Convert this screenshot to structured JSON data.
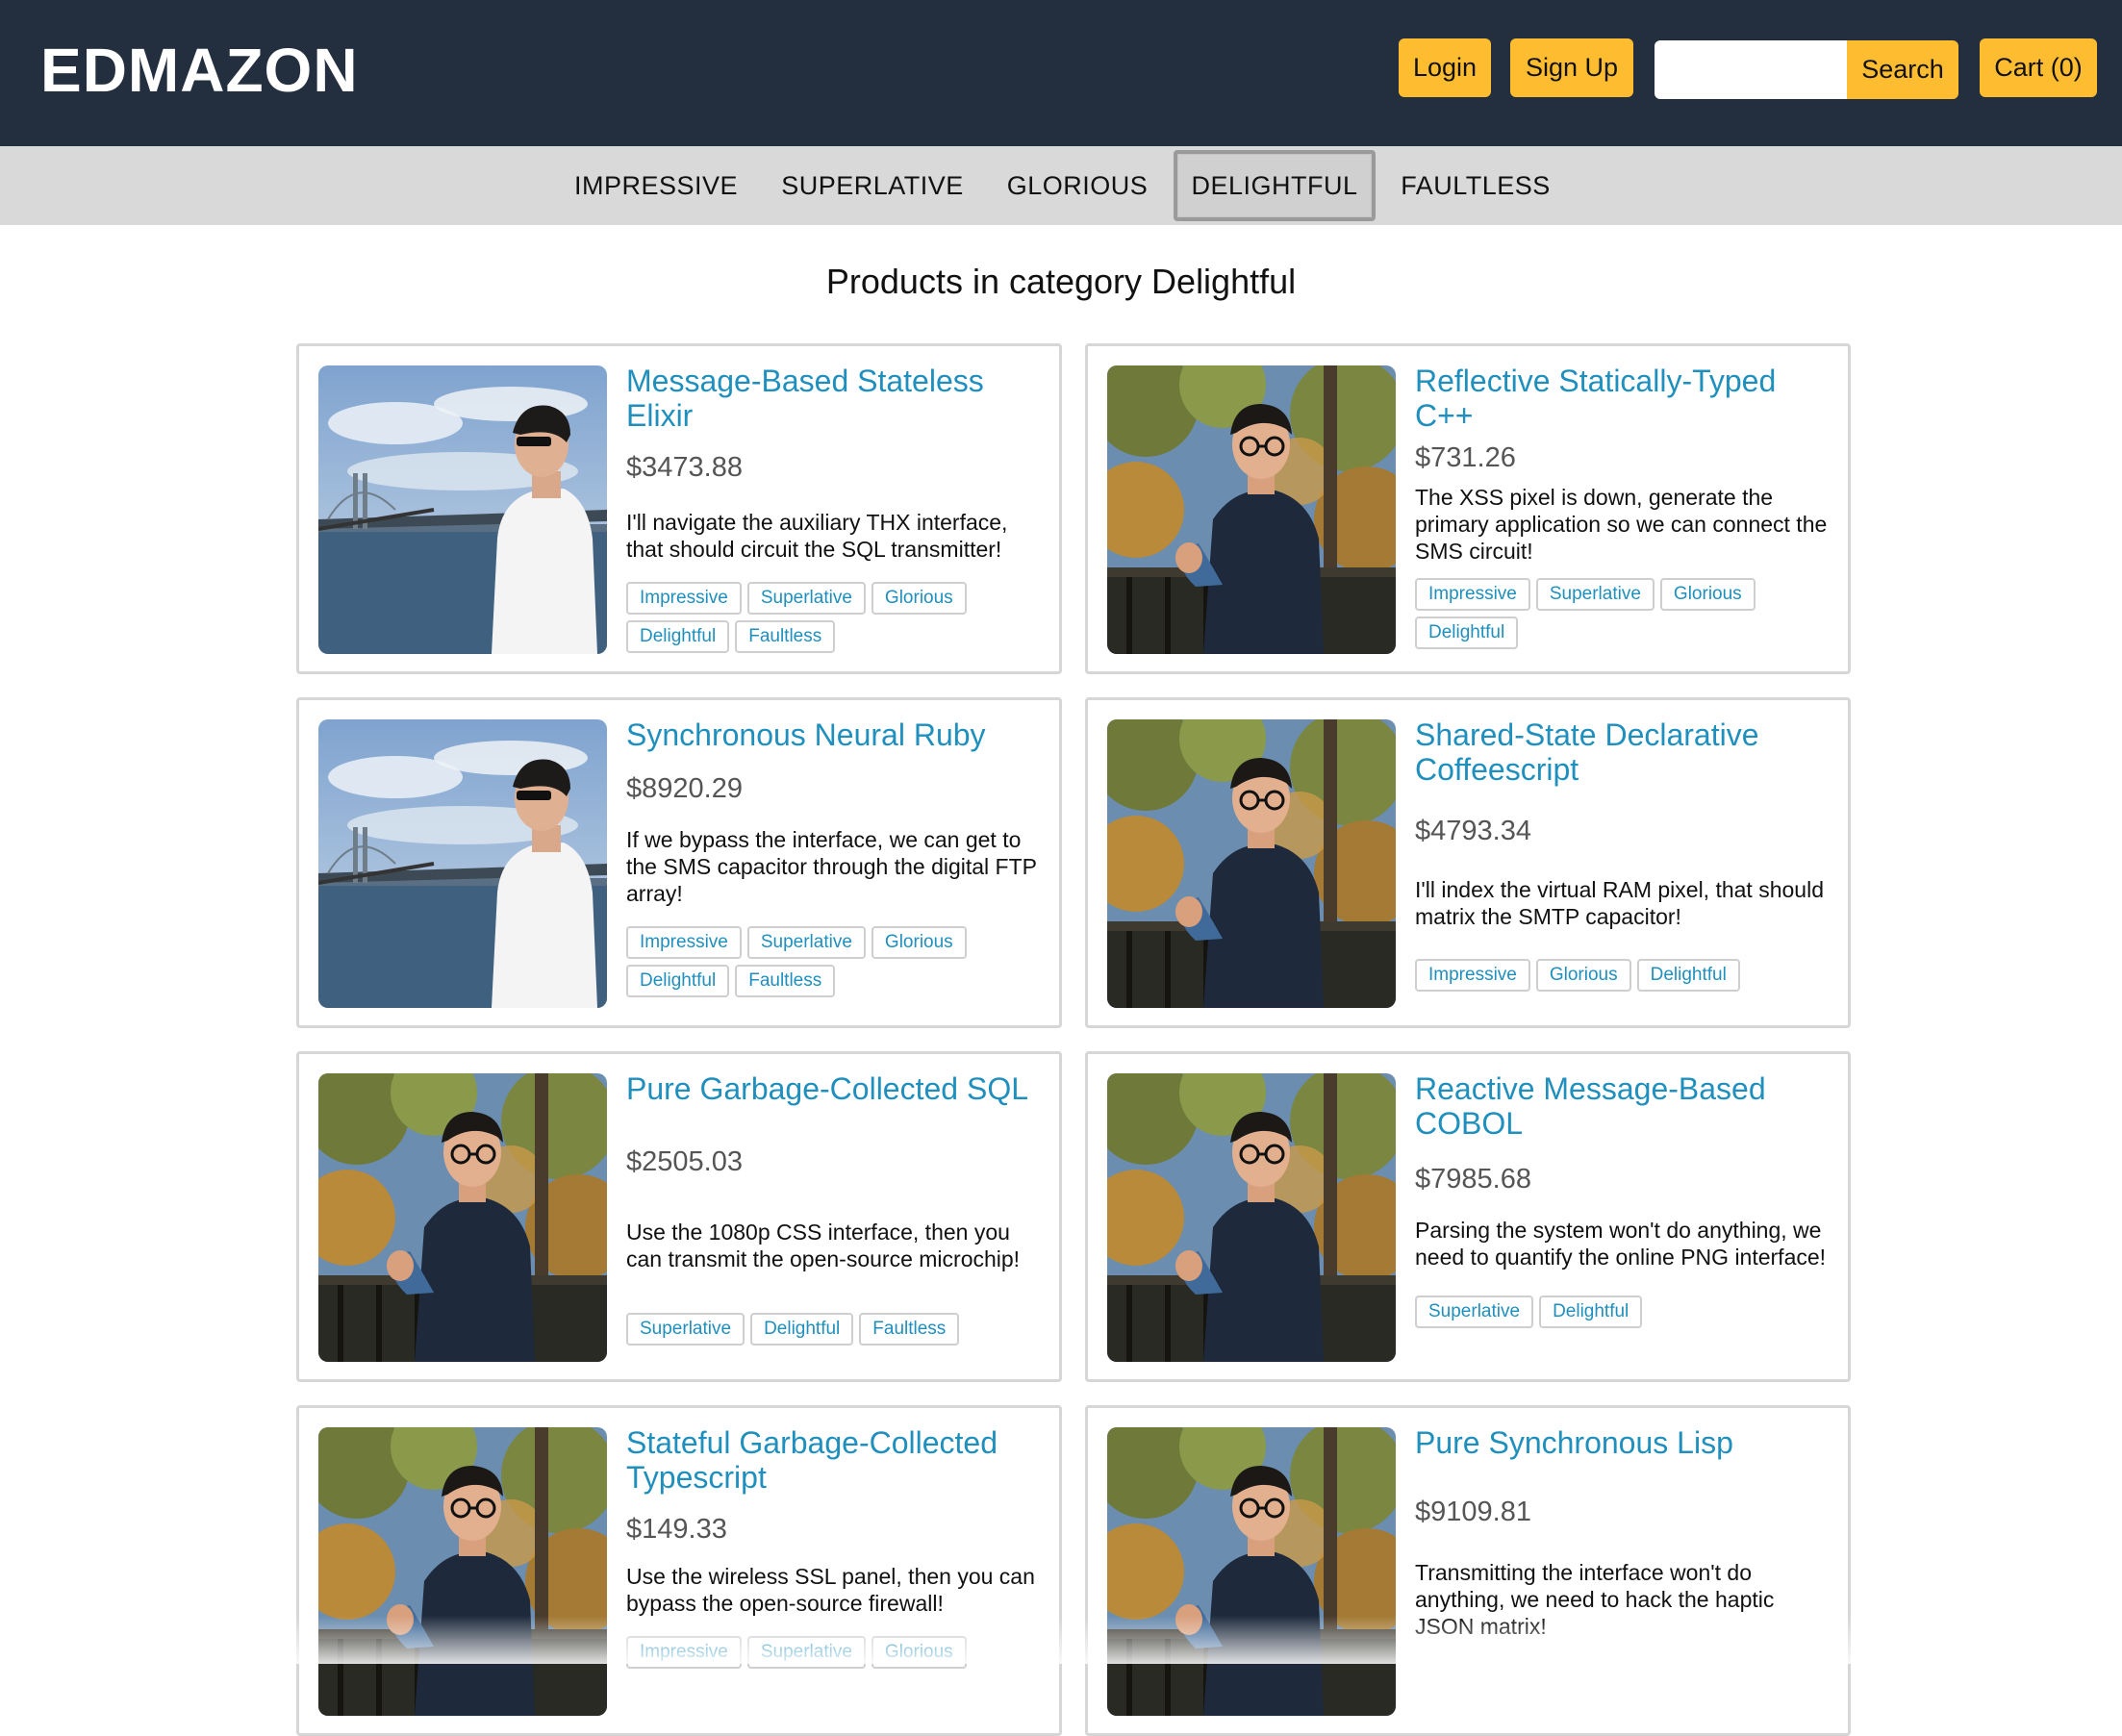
{
  "header": {
    "logo": "EDMAZON",
    "login_label": "Login",
    "signup_label": "Sign Up",
    "search_placeholder": "",
    "search_label": "Search",
    "cart_label": "Cart (0)"
  },
  "nav": {
    "tabs": [
      {
        "label": "IMPRESSIVE"
      },
      {
        "label": "SUPERLATIVE"
      },
      {
        "label": "GLORIOUS"
      },
      {
        "label": "DELIGHTFUL"
      },
      {
        "label": "FAULTLESS"
      }
    ],
    "active": "DELIGHTFUL"
  },
  "main": {
    "title": "Products in category Delightful"
  },
  "products": [
    {
      "name": "Message-Based Stateless Elixir",
      "price": "$3473.88",
      "description": "I'll navigate the auxiliary THX interface, that should circuit the SQL transmitter!",
      "tags": [
        "Impressive",
        "Superlative",
        "Glorious",
        "Delightful",
        "Faultless"
      ],
      "photo": "bridge-photo"
    },
    {
      "name": "Reflective Statically-Typed C++",
      "price": "$731.26",
      "description": "The XSS pixel is down, generate the primary application so we can connect the SMS circuit!",
      "tags": [
        "Impressive",
        "Superlative",
        "Glorious",
        "Delightful"
      ],
      "photo": "trees-photo"
    },
    {
      "name": "Synchronous Neural Ruby",
      "price": "$8920.29",
      "description": "If we bypass the interface, we can get to the SMS capacitor through the digital FTP array!",
      "tags": [
        "Impressive",
        "Superlative",
        "Glorious",
        "Delightful",
        "Faultless"
      ],
      "photo": "bridge-photo"
    },
    {
      "name": "Shared-State Declarative Coffeescript",
      "price": "$4793.34",
      "description": "I'll index the virtual RAM pixel, that should matrix the SMTP capacitor!",
      "tags": [
        "Impressive",
        "Glorious",
        "Delightful"
      ],
      "photo": "trees-photo"
    },
    {
      "name": "Pure Garbage-Collected SQL",
      "price": "$2505.03",
      "description": "Use the 1080p CSS interface, then you can transmit the open-source microchip!",
      "tags": [
        "Superlative",
        "Delightful",
        "Faultless"
      ],
      "photo": "trees-photo"
    },
    {
      "name": "Reactive Message-Based COBOL",
      "price": "$7985.68",
      "description": "Parsing the system won't do anything, we need to quantify the online PNG interface!",
      "tags": [
        "Superlative",
        "Delightful"
      ],
      "photo": "trees-photo"
    },
    {
      "name": "Stateful Garbage-Collected Typescript",
      "price": "$149.33",
      "description": "Use the wireless SSL panel, then you can bypass the open-source firewall!",
      "tags": [
        "Impressive",
        "Superlative",
        "Glorious"
      ],
      "photo": "trees-photo"
    },
    {
      "name": "Pure Synchronous Lisp",
      "price": "$9109.81",
      "description": "Transmitting the interface won't do anything, we need to hack the haptic JSON matrix!",
      "tags": [],
      "photo": "trees-photo"
    }
  ],
  "colors": {
    "header_bg": "#232f3f",
    "accent": "#febd30",
    "link": "#1f8fbd"
  }
}
